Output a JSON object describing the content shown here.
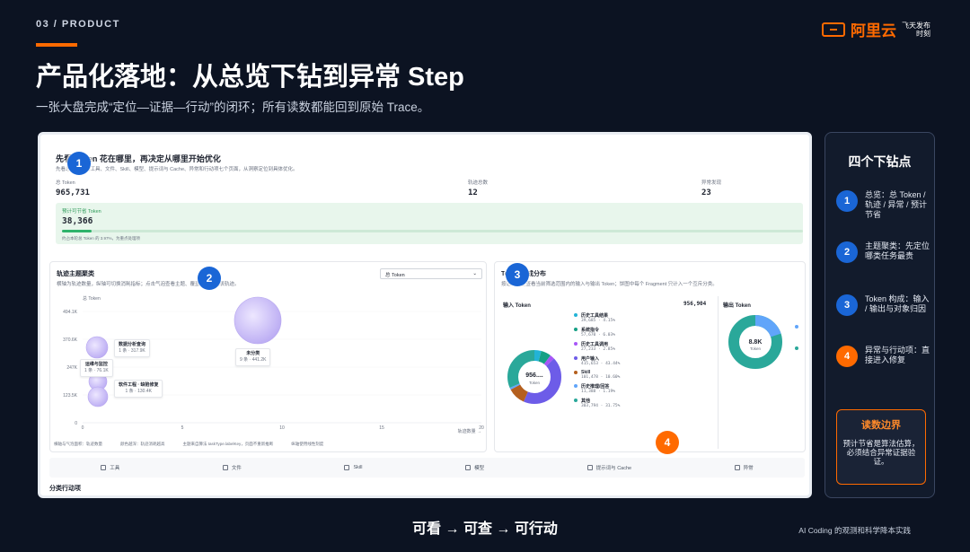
{
  "header": {
    "section_tag": "03 / PRODUCT",
    "brand_name": "阿里云",
    "brand_sub1": "飞天发布",
    "brand_sub2": "时刻",
    "title": "产品化落地：从总览下钻到异常 Step",
    "subtitle": "一张大盘完成“定位—证据—行动”的闭环；所有读数都能回到原始 Trace。"
  },
  "dashboard": {
    "head_title": "先看 Token 花在哪里，再决定从哪里开始优化",
    "head_desc": "先看总量，再按工具、文件、Skill、模型、提示词与 Cache、异常和行动项七个页面，从洞察定位到具体优化。",
    "metrics": [
      {
        "label": "总 Token",
        "value": "965,731"
      },
      {
        "label": "轨迹总数",
        "value": "12"
      },
      {
        "label": "异常发现",
        "value": "23"
      }
    ],
    "savings": {
      "label": "预计可节省 Token",
      "value": "38,366",
      "note": "约占本轮总 Token 的 3.97%，为重点处理项",
      "fraction": 0.0397
    },
    "cluster": {
      "title": "轨迹主题聚类",
      "desc": "横轴为轨迹数量，纵轴可切换消耗指标；点击气泡查看主题、覆盖结构和代表轨迹。",
      "select_label": "总 Token",
      "select_caret": "⌄",
      "ylabel": "总 Token",
      "xlabel": "轨迹数量 →",
      "y_ticks": [
        "494.1K",
        "370.6K",
        "247K",
        "123.5K",
        "0"
      ],
      "x_ticks": [
        "0",
        "5",
        "10",
        "15",
        "20"
      ],
      "bubbles": [
        {
          "name": "数据分析查询",
          "sub": "1 条 · 317.9K"
        },
        {
          "name": "运维与监控",
          "sub": "1 条 · 76.1K"
        },
        {
          "name": "软件工程 · 缺陷修复",
          "sub": "1 条 · 130.4K"
        },
        {
          "name": "未分类",
          "sub": "9 条 · 441.2K"
        }
      ],
      "legend": [
        "横轴与气泡面积：轨迹数量",
        "颜色越深：轨迹消耗越高",
        "主题来自算法 taskType.labelKey，页面不重新推断",
        "纵轴使用线性刻度"
      ]
    },
    "token_dist": {
      "title": "Token 构成分布",
      "desc": "按语义类型查看当前筛选范围内的输入与输出 Token；饼图中每个 Fragment 只计入一个互斥分类。",
      "input_label": "输入 Token",
      "input_total": "956,904",
      "input_center": "956....",
      "center_unit": "Token",
      "output_label": "输出 Token",
      "output_center": "8.8K",
      "items": [
        {
          "name": "历史工具结果",
          "sub": "39,685 · 4.15%",
          "color": "#22b3d6"
        },
        {
          "name": "系统指令",
          "sub": "57,670 · 6.03%",
          "color": "#16a085"
        },
        {
          "name": "历史工具调用",
          "sub": "27,233 · 2.85%",
          "color": "#a855f7"
        },
        {
          "name": "用户输入",
          "sub": "415,653 · 43.44%",
          "color": "#6d5ce8"
        },
        {
          "name": "Skill",
          "sub": "101,478 · 10.60%",
          "color": "#b45f1e"
        },
        {
          "name": "历史推理/回答",
          "sub": "11,388 · 1.19%",
          "color": "#60a5fa"
        },
        {
          "name": "其他",
          "sub": "303,794 · 31.75%",
          "color": "#2aa89a"
        }
      ]
    },
    "nav": [
      "工具",
      "文件",
      "Skill",
      "模型",
      "提示词与 Cache",
      "异常"
    ],
    "cut_text": "分类行动项"
  },
  "markers": [
    "1",
    "2",
    "3",
    "4"
  ],
  "side": {
    "title": "四个下钻点",
    "items": [
      {
        "num": "1",
        "text": "总览：总 Token / 轨迹 / 异常 / 预计节省"
      },
      {
        "num": "2",
        "text": "主题聚类：先定位哪类任务最贵"
      },
      {
        "num": "3",
        "text": "Token 构成：输入 / 输出与对象归因"
      },
      {
        "num": "4",
        "text": "异常与行动项：直接进入修复"
      }
    ],
    "box_title": "读数边界",
    "box_text": "预计节省是算法估算，必须结合异常证据验证。"
  },
  "footer": {
    "flow": "可看 → 可查 → 可行动",
    "credit": "AI Coding 的观测和科学降本实践"
  },
  "colors": {
    "accent": "#ff6a00",
    "marker_blue": "#1a66d6",
    "background": "#0c1322"
  }
}
